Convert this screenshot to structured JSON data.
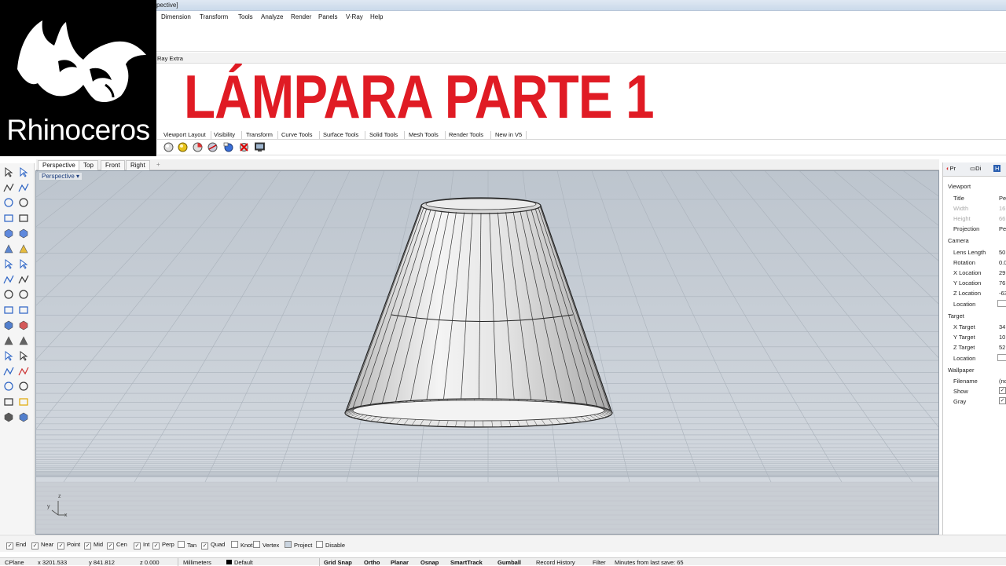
{
  "window": {
    "title_fragment": "pective]"
  },
  "menu": [
    "Dimension",
    "Transform",
    "Tools",
    "Analyze",
    "Render",
    "Panels",
    "V-Ray",
    "Help"
  ],
  "top_tab": "Ray Extra",
  "logo": {
    "text": "Rhinoceros"
  },
  "headline": "LÁMPARA PARTE 1",
  "toolbar_tabs": [
    "Viewport Layout",
    "Visibility",
    "Transform",
    "Curve Tools",
    "Surface Tools",
    "Solid Tools",
    "Mesh Tools",
    "Render Tools",
    "New in V5"
  ],
  "viewport_tabs": [
    "Perspective",
    "Top",
    "Front",
    "Right"
  ],
  "viewport_tab_add": "+",
  "viewport": {
    "label": "Perspective",
    "axis_y": "y",
    "axis_z": "z",
    "axis_x": "x"
  },
  "right_panel": {
    "tabs": [
      "Pr",
      "Di",
      "H"
    ],
    "sections": {
      "viewport": "Viewport",
      "camera": "Camera",
      "target": "Target",
      "wallpaper": "Wallpaper"
    },
    "props": {
      "title": {
        "label": "Title",
        "value": "Pe"
      },
      "width": {
        "label": "Width",
        "value": "16"
      },
      "height": {
        "label": "Height",
        "value": "66"
      },
      "projection": {
        "label": "Projection",
        "value": "Pe"
      },
      "lens_length": {
        "label": "Lens Length",
        "value": "50"
      },
      "rotation": {
        "label": "Rotation",
        "value": "0.0"
      },
      "x_location": {
        "label": "X Location",
        "value": "29"
      },
      "y_location": {
        "label": "Y Location",
        "value": "76"
      },
      "z_location": {
        "label": "Z Location",
        "value": "-63"
      },
      "location": {
        "label": "Location"
      },
      "x_target": {
        "label": "X Target",
        "value": "34"
      },
      "y_target": {
        "label": "Y Target",
        "value": "10"
      },
      "z_target": {
        "label": "Z Target",
        "value": "52"
      },
      "target_location": {
        "label": "Location"
      },
      "filename": {
        "label": "Filename",
        "value": "(no"
      },
      "show": {
        "label": "Show",
        "checked": "✓"
      },
      "gray": {
        "label": "Gray",
        "checked": "✓"
      }
    }
  },
  "osnaps": [
    {
      "label": "End",
      "checked": "✓"
    },
    {
      "label": "Near",
      "checked": "✓"
    },
    {
      "label": "Point",
      "checked": "✓"
    },
    {
      "label": "Mid",
      "checked": "✓"
    },
    {
      "label": "Cen",
      "checked": "✓"
    },
    {
      "label": "Int",
      "checked": "✓"
    },
    {
      "label": "Perp",
      "checked": "✓"
    },
    {
      "label": "Tan",
      "checked": ""
    },
    {
      "label": "Quad",
      "checked": "✓"
    },
    {
      "label": "Knot",
      "checked": ""
    },
    {
      "label": "Vertex",
      "checked": ""
    },
    {
      "label": "Project",
      "checked": ""
    },
    {
      "label": "Disable",
      "checked": ""
    }
  ],
  "status": {
    "cplane": "CPlane",
    "x": "x 3201.533",
    "y": "y 841.812",
    "z": "z 0.000",
    "units": "Millimeters",
    "layer": "Default",
    "grid_snap": "Grid Snap",
    "ortho": "Ortho",
    "planar": "Planar",
    "osnap": "Osnap",
    "smarttrack": "SmartTrack",
    "gumball": "Gumball",
    "record_history": "Record History",
    "filter": "Filter",
    "last_save": "Minutes from last save: 65"
  },
  "colors": {
    "headline": "#e01b24",
    "viewport_bg": "#c5ccd4",
    "logo_bg": "#000000"
  }
}
